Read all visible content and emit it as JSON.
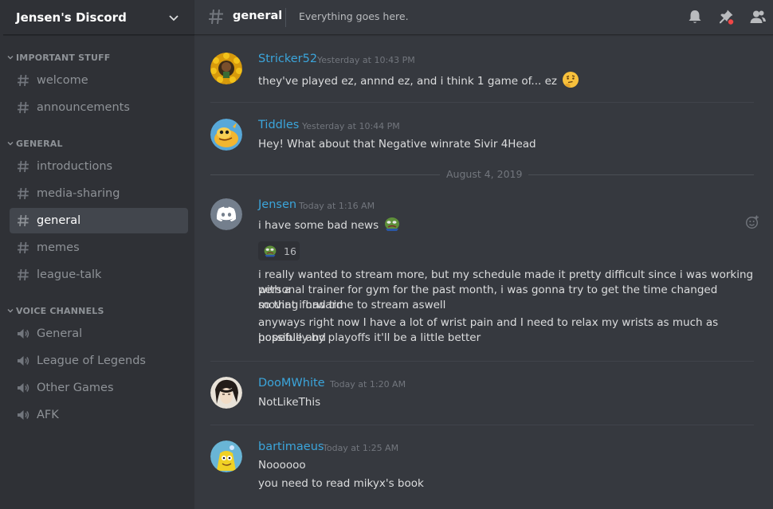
{
  "server": {
    "name": "Jensen's Discord"
  },
  "categories": [
    {
      "label": "IMPORTANT STUFF"
    },
    {
      "label": "GENERAL"
    },
    {
      "label": "VOICE CHANNELS"
    }
  ],
  "text_channels": [
    {
      "label": "welcome"
    },
    {
      "label": "announcements"
    },
    {
      "label": "introductions"
    },
    {
      "label": "media-sharing"
    },
    {
      "label": "general",
      "active": true
    },
    {
      "label": "memes"
    },
    {
      "label": "league-talk"
    }
  ],
  "voice_channels": [
    {
      "label": "General"
    },
    {
      "label": "League of Legends"
    },
    {
      "label": "Other Games"
    },
    {
      "label": "AFK"
    }
  ],
  "header": {
    "channel_name": "general",
    "topic": "Everything goes here.",
    "icons": [
      "bell-icon",
      "pin-icon",
      "members-icon"
    ]
  },
  "messages": [
    {
      "author": "Stricker52",
      "timestamp": "Yesterday at 10:43 PM",
      "lines": [
        "they've played ez, annnd ez, and i think 1 game of... ez"
      ],
      "emoji": "thinking-emoji"
    },
    {
      "author": "Tiddles",
      "timestamp": "Yesterday at 10:44 PM",
      "lines": [
        "Hey! What about that Negative winrate Sivir 4Head"
      ]
    },
    {
      "author": "Jensen",
      "timestamp": "Today at 1:16 AM",
      "lines": [
        "i have some bad news",
        "i really wanted to stream more, but my schedule made it pretty difficult since i was working with a",
        "personal trainer for gym for the past month, i was gonna try to get the time changed moving forward",
        "so that i had time to stream aswell",
        "anyways right now I have a lot of wrist pain and I need to relax my wrists as much as possible and",
        "hopefully by playoffs it'll be a little better"
      ],
      "reaction": {
        "emoji": "feelsbadman-emoji",
        "count": "16"
      }
    },
    {
      "author": "DooMWhite",
      "timestamp": "Today at 1:20 AM",
      "lines": [
        "NotLikeThis"
      ]
    },
    {
      "author": "bartimaeus",
      "timestamp": "Today at 1:25 AM",
      "lines": [
        "Noooooo",
        "you need to read mikyx's book"
      ]
    }
  ],
  "date_divider": "August 4, 2019",
  "colors": {
    "link": "#3ba5db",
    "bg": "#36393f",
    "sidebar": "#2f3136",
    "active": "#42464d"
  }
}
